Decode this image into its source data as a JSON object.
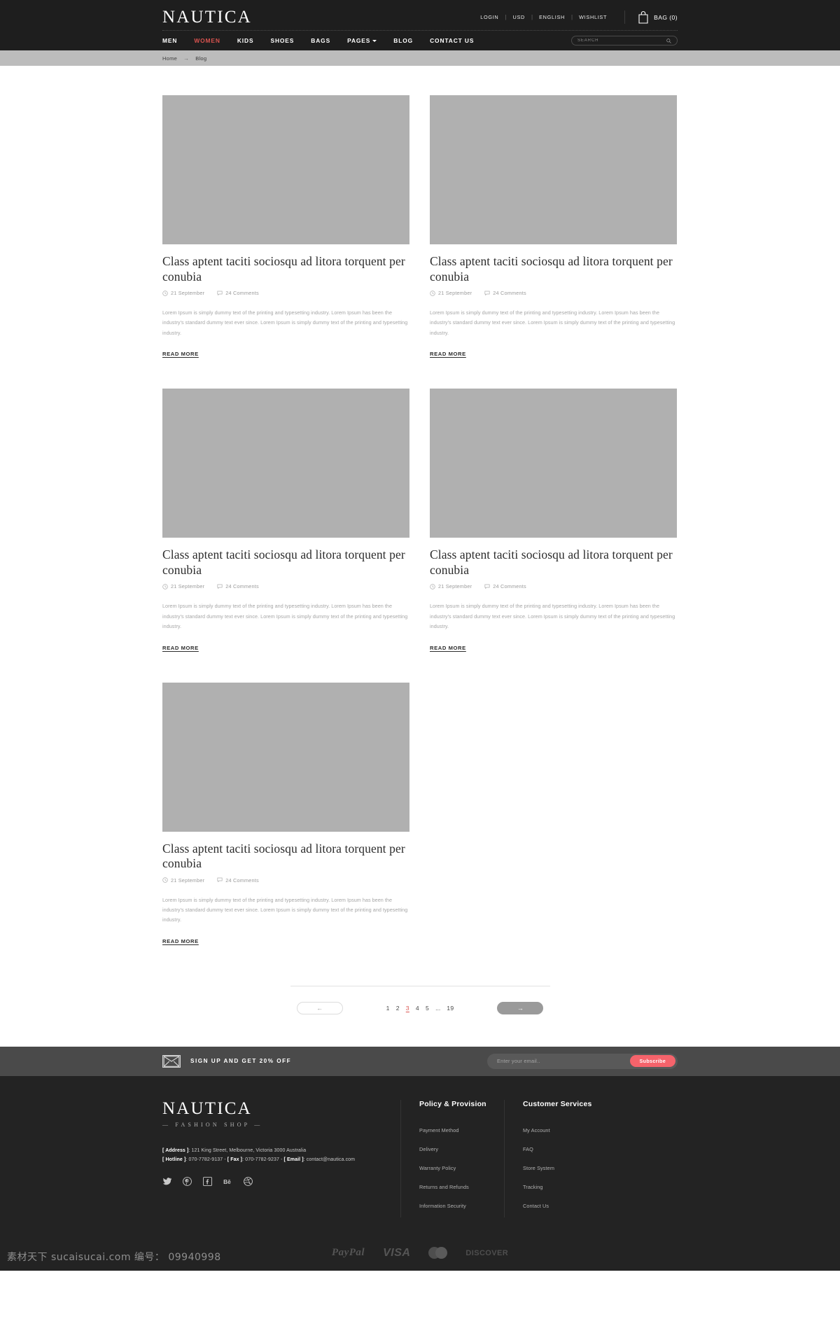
{
  "header": {
    "logo": "NAUTICA",
    "top_links": [
      {
        "label": "LOGIN"
      },
      {
        "label": "USD"
      },
      {
        "label": "ENGLISH"
      },
      {
        "label": "WISHLIST"
      }
    ],
    "bag_label": "BAG (0)",
    "nav": [
      {
        "label": "MEN",
        "active": false
      },
      {
        "label": "WOMEN",
        "active": true
      },
      {
        "label": "KIDS",
        "active": false
      },
      {
        "label": "SHOES",
        "active": false
      },
      {
        "label": "BAGS",
        "active": false
      },
      {
        "label": "PAGES",
        "active": false,
        "has_caret": true
      },
      {
        "label": "BLOG",
        "active": false
      },
      {
        "label": "CONTACT US",
        "active": false
      }
    ],
    "search_placeholder": "SEARCH",
    "search_value": "",
    "accent_color": "#d9534f"
  },
  "breadcrumb": {
    "home": "Home",
    "arrow": "→",
    "current": "Blog"
  },
  "posts": [
    {
      "title": "Class aptent taciti sociosqu ad litora torquent per conubia",
      "date": "21 September",
      "comments": "24 Comments",
      "excerpt": "Lorem Ipsum is simply dummy text of the printing and typesetting industry. Lorem Ipsum has been the industry's standard dummy text ever since. Lorem Ipsum is simply dummy text of the printing and typesetting industry.",
      "read_more": "READ MORE"
    },
    {
      "title": "Class aptent taciti sociosqu ad litora torquent per conubia",
      "date": "21 September",
      "comments": "24 Comments",
      "excerpt": "Lorem Ipsum is simply dummy text of the printing and typesetting industry. Lorem Ipsum has been the industry's standard dummy text ever since. Lorem Ipsum is simply dummy text of the printing and typesetting industry.",
      "read_more": "READ MORE"
    },
    {
      "title": "Class aptent taciti sociosqu ad litora torquent per conubia",
      "date": "21 September",
      "comments": "24 Comments",
      "excerpt": "Lorem Ipsum is simply dummy text of the printing and typesetting industry. Lorem Ipsum has been the industry's standard dummy text ever since. Lorem Ipsum is simply dummy text of the printing and typesetting industry.",
      "read_more": "READ MORE"
    },
    {
      "title": "Class aptent taciti sociosqu ad litora torquent per conubia",
      "date": "21 September",
      "comments": "24 Comments",
      "excerpt": "Lorem Ipsum is simply dummy text of the printing and typesetting industry. Lorem Ipsum has been the industry's standard dummy text ever since. Lorem Ipsum is simply dummy text of the printing and typesetting industry.",
      "read_more": "READ MORE"
    },
    {
      "title": "Class aptent taciti sociosqu ad litora torquent per conubia",
      "date": "21 September",
      "comments": "24 Comments",
      "excerpt": "Lorem Ipsum is simply dummy text of the printing and typesetting industry. Lorem Ipsum has been the industry's standard dummy text ever since. Lorem Ipsum is simply dummy text of the printing and typesetting industry.",
      "read_more": "READ MORE"
    }
  ],
  "pagination": {
    "prev_glyph": "←",
    "next_glyph": "→",
    "pages": [
      "1",
      "2",
      "3",
      "4",
      "5"
    ],
    "ellipsis": "...",
    "last_page": "19",
    "active_page": "3"
  },
  "newsletter": {
    "headline": "SIGN UP AND GET 20% OFF",
    "placeholder": "Enter your email..",
    "value": "",
    "button": "Subscribe",
    "button_color": "#f5636b"
  },
  "footer": {
    "logo": "NAUTICA",
    "tagline": "— FASHION SHOP —",
    "address_label": "[ Address ]",
    "address_value": ": 121 King Street, Melbourne,  Victoria 3000 Australia",
    "hotline_label": "[ Hotline ]",
    "hotline_value": ": 070-7782-9137",
    "sep1": "-",
    "fax_label": "[ Fax ]",
    "fax_value": ": 070-7782-9237",
    "sep2": "-",
    "email_label": "[ Email ]",
    "email_value": ": contact@nautica.com",
    "social": [
      "twitter-icon",
      "pinterest-icon",
      "facebook-icon",
      "behance-icon",
      "dribbble-icon"
    ],
    "columns": [
      {
        "title": "Policy & Provision",
        "links": [
          "Payment Method",
          "Delivery",
          "Warranty Policy",
          "Returns and Refunds",
          "Information Security"
        ]
      },
      {
        "title": "Customer Services",
        "links": [
          "My Account",
          "FAQ",
          "Store System",
          "Tracking",
          "Contact Us"
        ]
      }
    ],
    "payments": [
      "PayPal",
      "VISA",
      "MasterCard",
      "DISCOVER"
    ],
    "watermark": "素材天下 sucaisucai.com  编号： 09940998"
  }
}
